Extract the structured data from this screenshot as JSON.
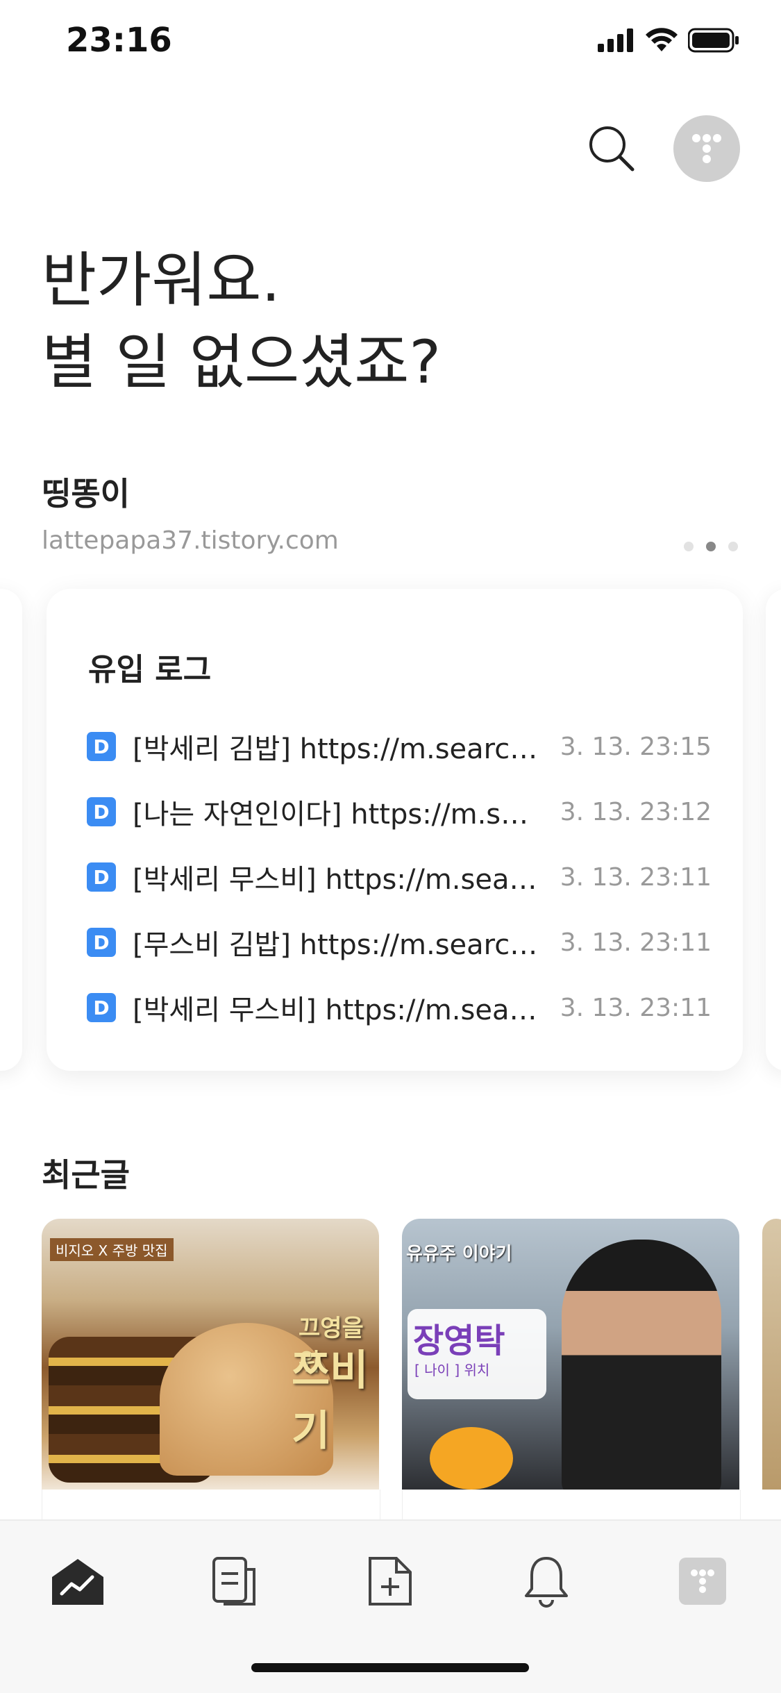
{
  "status_bar": {
    "time": "23:16"
  },
  "greeting": {
    "line1": "반가워요.",
    "line2": "별 일 없으셨죠?"
  },
  "blog": {
    "name": "띵똥이",
    "url": "lattepapa37.tistory.com"
  },
  "carousel": {
    "pages": 3,
    "active_index": 1
  },
  "inflow_log": {
    "title": "유입 로그",
    "entries": [
      {
        "icon": "D",
        "text": "[박세리 김밥] https://m.search.naver.com",
        "time": "3. 13. 23:15"
      },
      {
        "icon": "D",
        "text": "[나는 자연인이다] https://m.search.naver.com",
        "time": "3. 13. 23:12"
      },
      {
        "icon": "D",
        "text": "[박세리 무스비] https://m.search.naver.com",
        "time": "3. 13. 23:11"
      },
      {
        "icon": "D",
        "text": "[무스비 김밥] https://m.search.naver.com",
        "time": "3. 13. 23:11"
      },
      {
        "icon": "D",
        "text": "[박세리 무스비] https://m.search.naver.com",
        "time": "3. 13. 23:11"
      }
    ]
  },
  "recent_posts": {
    "title": "최근글",
    "posts": [
      {
        "thumb_caption": "끄영을 위",
        "thumb_caption2": "쯔비기",
        "thumb_tag": "비지오 X 주방 맛집"
      },
      {
        "thumb_top_caption": "유유주 이야기",
        "thumb_name": "장영탁",
        "thumb_sub": "[ 나이 ]  위치"
      }
    ]
  },
  "tabbar": {
    "items": [
      {
        "icon": "home-chart-icon",
        "active": true
      },
      {
        "icon": "posts-icon",
        "active": false
      },
      {
        "icon": "new-post-icon",
        "active": false
      },
      {
        "icon": "bell-icon",
        "active": false
      },
      {
        "icon": "tistory-icon",
        "active": false
      }
    ]
  },
  "colors": {
    "accent_blue": "#3b8cf3",
    "text_primary": "#222222",
    "text_secondary": "#999999"
  }
}
